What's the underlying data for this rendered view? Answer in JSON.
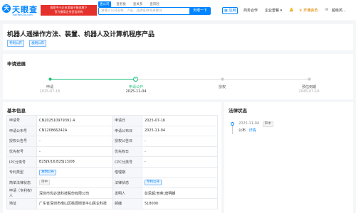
{
  "header": {
    "logo_mark": "天",
    "logo_text": "天眼查",
    "logo_sub": "TianYanCha.com",
    "promo_line1": "国家中小企业发展子基金旗下",
    "promo_line2": "官方备案企业征信机构",
    "promo_line3": "查公司·查老板·查关系",
    "search_tabs": [
      "查公司",
      "查老板",
      "查关系",
      "查风险"
    ],
    "search_placeholder": "请输入公司名称、人名、品牌名称等关键词",
    "search_button": "天眼一下",
    "app": "应用",
    "business_partner": "商务合作",
    "enterprise_package": "企业套餐",
    "vip": "开通会员",
    "user": "超级风..."
  },
  "title_card": {
    "title": "机器人遥操作方法、装置、机器人及计算机程序产品",
    "tags": [
      "专利公开",
      "发明公布"
    ]
  },
  "progress": {
    "title": "申请进展",
    "steps": [
      {
        "name": "申请",
        "date": "2025-07-16",
        "state": "done"
      },
      {
        "name": "申请公开",
        "date": "2025-11-04",
        "state": "current"
      },
      {
        "name": "授权",
        "date": "",
        "state": "pending"
      },
      {
        "name": "预估到期",
        "date": "2045-07-16",
        "state": "pending"
      }
    ]
  },
  "basic_info": {
    "title": "基本信息",
    "rows": [
      {
        "l1": "申请号",
        "v1": "CN202510979391.4",
        "l2": "申请日",
        "v2": "2025-07-16"
      },
      {
        "l1": "申请公布号",
        "v1": "CN120866242A",
        "l2": "申请公布日",
        "v2": "2025-11-04"
      },
      {
        "l1": "授权公告号",
        "v1": "-",
        "l2": "授权公告日",
        "v2": "-"
      },
      {
        "l1": "优先权号",
        "v1": "-",
        "l2": "优先权日",
        "v2": "-"
      },
      {
        "l1": "IPC分类号",
        "v1": "B25J9/16;B25J13/08",
        "l2": "CPC分类号",
        "v2": "-"
      },
      {
        "l1": "专利类型",
        "v1": "发明公布",
        "l2": "借理期",
        "v2": ""
      },
      {
        "l1": "简单法律状态",
        "v1": "审中",
        "l2": "法律状态",
        "v2": "专利公开"
      },
      {
        "l1": "申请（专利权）人",
        "v1": "深圳市优必选科技股份有限公司",
        "l2": "发明人",
        "v2": "彭思超;邢荣;唐明朗"
      },
      {
        "l1": "地址",
        "v1": "广东省深圳市南山区桃源街道平山民企科技",
        "l2": "邮编",
        "v2": "518000"
      }
    ]
  },
  "legal_status": {
    "title": "法律状态",
    "date": "2025-11-04",
    "badge": "审中",
    "text": "公布",
    "link": "详情"
  },
  "colors": {
    "accent": "#0084ff",
    "done": "#1ec17b",
    "promo": "#e5312b",
    "vip": "#e8a23b"
  }
}
